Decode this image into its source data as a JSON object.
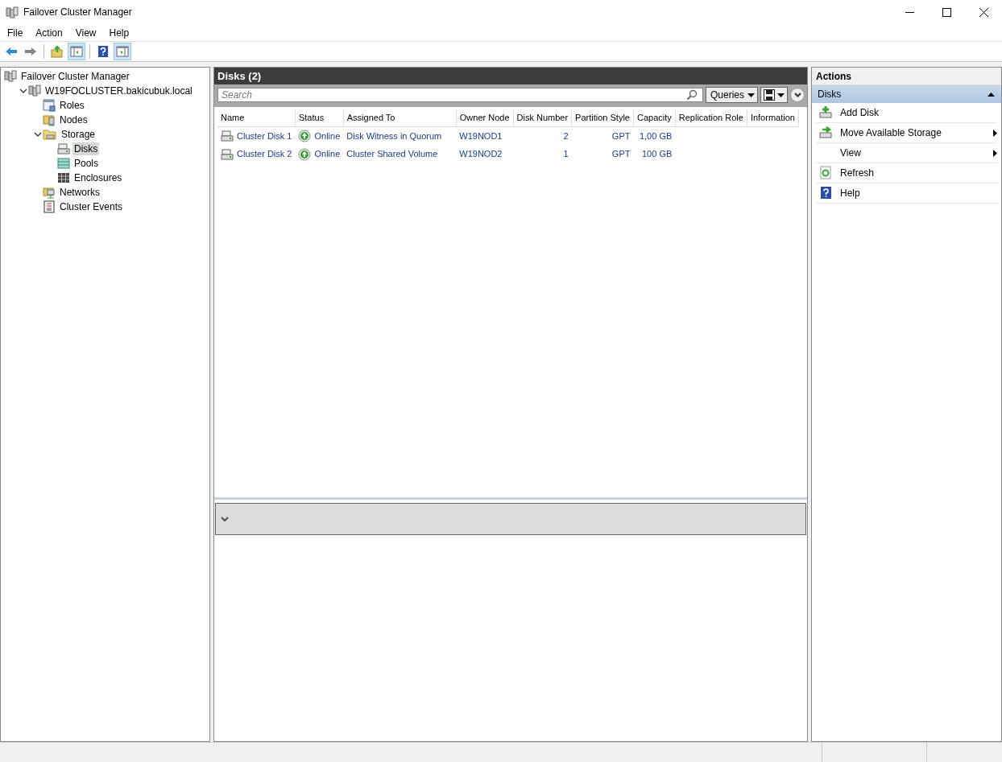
{
  "window": {
    "title": "Failover Cluster Manager"
  },
  "menu": [
    "File",
    "Action",
    "View",
    "Help"
  ],
  "toolbar": [
    {
      "kind": "back",
      "pressed": false
    },
    {
      "kind": "forward",
      "pressed": false
    },
    {
      "kind": "up",
      "pressed": false
    },
    {
      "kind": "tree-toggle",
      "pressed": true
    },
    {
      "kind": "help",
      "pressed": false
    },
    {
      "kind": "action-toggle",
      "pressed": true
    }
  ],
  "tree": [
    {
      "label": "Failover Cluster Manager",
      "selected": false,
      "children": [
        {
          "label": "W19FOCLUSTER.bakicubuk.local",
          "selected": false,
          "expanded": true,
          "children": [
            {
              "label": "Roles",
              "selected": false
            },
            {
              "label": "Nodes",
              "selected": false
            },
            {
              "label": "Storage",
              "selected": false,
              "expanded": true,
              "children": [
                {
                  "label": "Disks",
                  "selected": true
                },
                {
                  "label": "Pools",
                  "selected": false
                },
                {
                  "label": "Enclosures",
                  "selected": false
                }
              ]
            },
            {
              "label": "Networks",
              "selected": false
            },
            {
              "label": "Cluster Events",
              "selected": false
            }
          ]
        }
      ]
    }
  ],
  "center": {
    "title": "Disks (2)",
    "search": {
      "placeholder": "Search"
    },
    "queries_button": "Queries",
    "columns": [
      "Name",
      "Status",
      "Assigned To",
      "Owner Node",
      "Disk Number",
      "Partition Style",
      "Capacity",
      "Replication Role",
      "Information"
    ],
    "rows": [
      {
        "name": "Cluster Disk 1",
        "status": "Online",
        "assigned_to": "Disk Witness in Quorum",
        "owner_node": "W19NOD1",
        "disk_number": "2",
        "partition_style": "GPT",
        "capacity": "1,00 GB"
      },
      {
        "name": "Cluster Disk 2",
        "status": "Online",
        "assigned_to": "Cluster Shared Volume",
        "owner_node": "W19NOD2",
        "disk_number": "1",
        "partition_style": "GPT",
        "capacity": "100 GB"
      }
    ]
  },
  "actions": {
    "title": "Actions",
    "section": {
      "label": "Disks",
      "expanded": true
    },
    "items": [
      {
        "label": "Add Disk",
        "submenu": false
      },
      {
        "label": "Move Available Storage",
        "submenu": true
      },
      {
        "label": "View",
        "submenu": true
      },
      {
        "label": "Refresh",
        "submenu": false
      },
      {
        "label": "Help",
        "submenu": false
      }
    ]
  }
}
